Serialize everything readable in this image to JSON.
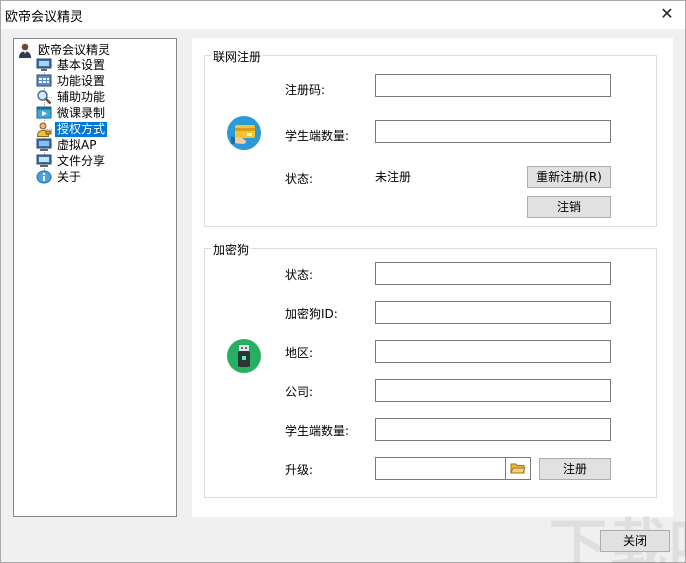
{
  "window": {
    "title": "欧帝会议精灵",
    "close_glyph": "✕"
  },
  "tree": {
    "root": {
      "label": "欧帝会议精灵",
      "icon": "user-icon"
    },
    "items": [
      {
        "label": "基本设置",
        "icon": "monitor-icon"
      },
      {
        "label": "功能设置",
        "icon": "grid-window-icon"
      },
      {
        "label": "辅助功能",
        "icon": "magnifier-icon"
      },
      {
        "label": "微课录制",
        "icon": "video-window-icon"
      },
      {
        "label": "授权方式",
        "icon": "user-key-icon",
        "selected": true
      },
      {
        "label": "虚拟AP",
        "icon": "network-monitor-icon"
      },
      {
        "label": "文件分享",
        "icon": "share-monitor-icon"
      },
      {
        "label": "关于",
        "icon": "info-icon"
      }
    ]
  },
  "online_registration": {
    "title": "联网注册",
    "icon": "card-hand-icon",
    "reg_code_label": "注册码:",
    "reg_code_value": "",
    "student_count_label": "学生端数量:",
    "student_count_value": "",
    "status_label": "状态:",
    "status_value": "未注册",
    "reregister_button": "重新注册(R)",
    "cancel_button": "注销"
  },
  "dongle": {
    "title": "加密狗",
    "icon": "usb-dongle-icon",
    "status_label": "状态:",
    "status_value": "",
    "dongle_id_label": "加密狗ID:",
    "dongle_id_value": "",
    "region_label": "地区:",
    "region_value": "",
    "company_label": "公司:",
    "company_value": "",
    "student_count_label": "学生端数量:",
    "student_count_value": "",
    "upgrade_label": "升级:",
    "upgrade_value": "",
    "browse_icon": "folder-open-icon",
    "register_button": "注册"
  },
  "footer": {
    "close_button": "关闭"
  },
  "watermark": "下载吧",
  "colors": {
    "selection": "#0078d7",
    "card_icon_bg": "#2a9bd8",
    "dongle_icon_bg": "#27ae60"
  }
}
